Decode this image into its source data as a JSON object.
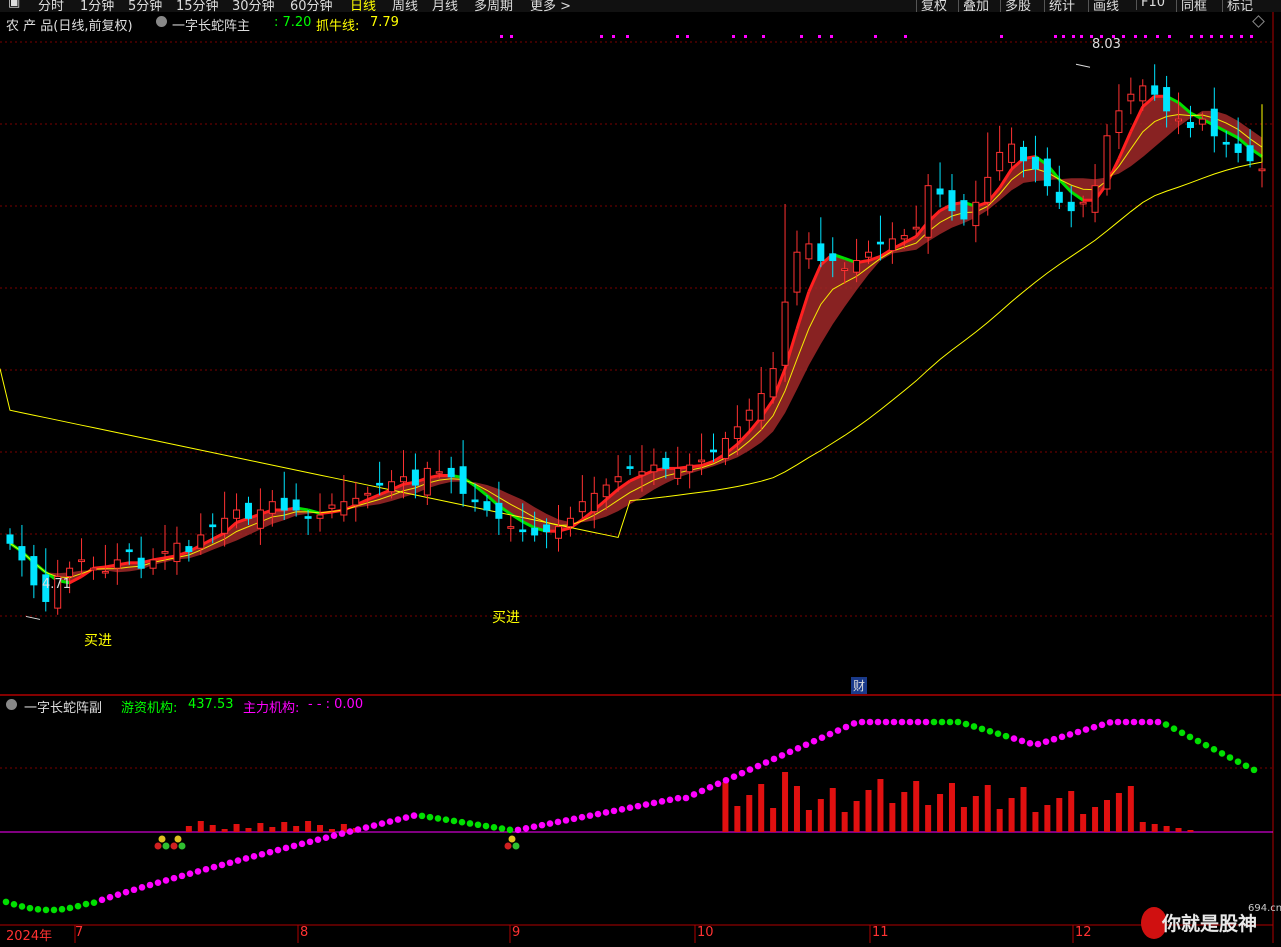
{
  "toolbar": {
    "periods": [
      "分时",
      "1分钟",
      "5分钟",
      "15分钟",
      "30分钟",
      "60分钟",
      "日线",
      "周线",
      "月线",
      "多周期",
      "更多 >"
    ],
    "active": "日线",
    "right": [
      "复权",
      "叠加",
      "多股",
      "统计",
      "画线",
      "F10",
      "同框",
      "标记"
    ]
  },
  "main_header": {
    "name": "农 产 品(日线,前复权)",
    "indicator": "一字长蛇阵主",
    "value1": ": 7.20",
    "label2": "抓牛线:",
    "value2": "7.79"
  },
  "sub_header": {
    "indicator": "一字长蛇阵副",
    "label1": "游资机构:",
    "value1": "437.53",
    "label2": "主力机构:",
    "value2": "- - : 0.00"
  },
  "annotations": {
    "high": "8.03",
    "low": "4.71",
    "buy1": "买进",
    "buy2": "买进",
    "finance": "财"
  },
  "x_axis": {
    "year": "2024年",
    "months": [
      "7",
      "8",
      "9",
      "10",
      "11",
      "12"
    ]
  },
  "watermark": {
    "text": "你就是股神",
    "site": "694.cn"
  },
  "colors": {
    "up": "#ff3232",
    "down": "#00e5ff",
    "ma_yellow": "#ffff00",
    "ribbon": "#a02828",
    "snake_green": "#00e000",
    "magenta": "#ff00ff",
    "grid": "#7a0000"
  },
  "chart_data": {
    "type": "candlestick",
    "price_range": [
      4.4,
      8.2
    ],
    "high_point": 8.03,
    "low_point": 4.71,
    "closes_approx": [
      5.15,
      5.05,
      4.9,
      4.8,
      4.95,
      5.0,
      5.05,
      5.0,
      4.98,
      5.05,
      5.1,
      5.0,
      5.05,
      5.1,
      5.15,
      5.1,
      5.2,
      5.25,
      5.3,
      5.35,
      5.3,
      5.35,
      5.4,
      5.35,
      5.35,
      5.3,
      5.32,
      5.38,
      5.4,
      5.42,
      5.45,
      5.5,
      5.52,
      5.55,
      5.5,
      5.6,
      5.58,
      5.55,
      5.45,
      5.4,
      5.35,
      5.3,
      5.25,
      5.22,
      5.2,
      5.22,
      5.25,
      5.3,
      5.4,
      5.45,
      5.5,
      5.55,
      5.6,
      5.58,
      5.62,
      5.6,
      5.6,
      5.62,
      5.65,
      5.7,
      5.78,
      5.85,
      5.95,
      6.05,
      6.2,
      6.6,
      6.9,
      6.95,
      6.85,
      6.85,
      6.8,
      6.85,
      6.9,
      6.95,
      6.98,
      7.0,
      7.05,
      7.3,
      7.25,
      7.15,
      7.1,
      7.2,
      7.35,
      7.5,
      7.55,
      7.45,
      7.4,
      7.3,
      7.2,
      7.15,
      7.2,
      7.3,
      7.6,
      7.75,
      7.85,
      7.9,
      7.85,
      7.75,
      7.7,
      7.65,
      7.7,
      7.6,
      7.55,
      7.5,
      7.45,
      7.4
    ],
    "sub": {
      "series": [
        {
          "name": "游资机构",
          "value": 437.53
        },
        {
          "name": "主力机构",
          "value": 0.0
        }
      ]
    }
  }
}
